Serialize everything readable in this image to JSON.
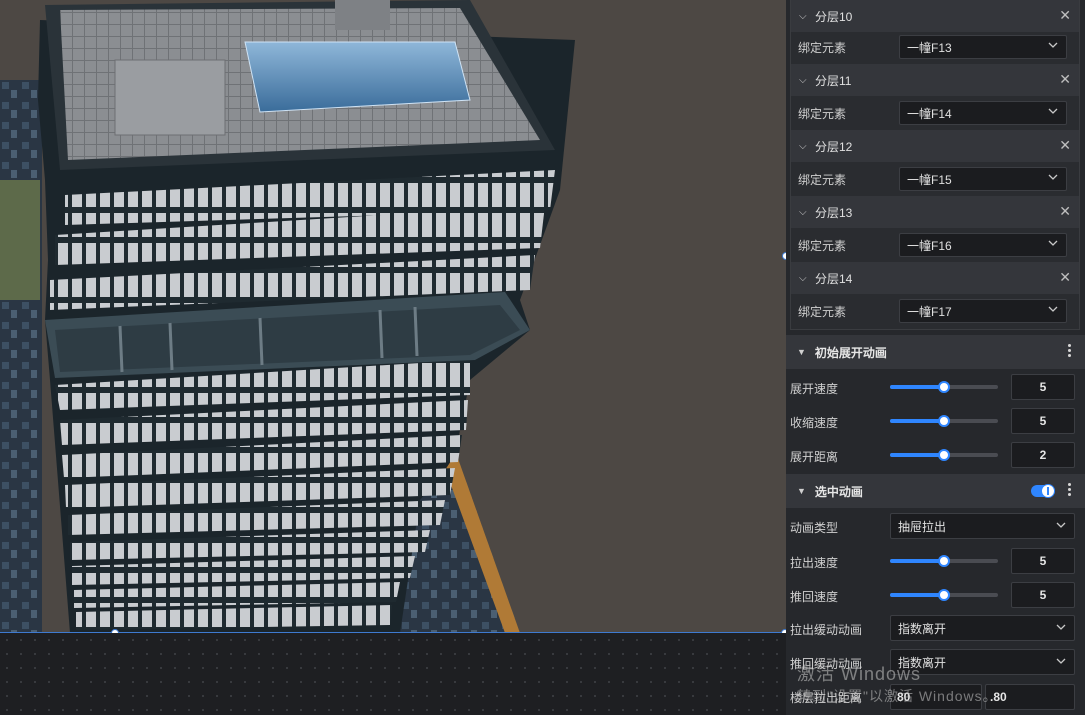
{
  "layers": [
    {
      "title": "分层10",
      "bind_label": "绑定元素",
      "bind_value": "一幢F13"
    },
    {
      "title": "分层11",
      "bind_label": "绑定元素",
      "bind_value": "一幢F14"
    },
    {
      "title": "分层12",
      "bind_label": "绑定元素",
      "bind_value": "一幢F15"
    },
    {
      "title": "分层13",
      "bind_label": "绑定元素",
      "bind_value": "一幢F16"
    },
    {
      "title": "分层14",
      "bind_label": "绑定元素",
      "bind_value": "一幢F17"
    }
  ],
  "initial_anim": {
    "title": "初始展开动画",
    "expand_speed": {
      "label": "展开速度",
      "value": "5",
      "fraction": 0.5
    },
    "shrink_speed": {
      "label": "收缩速度",
      "value": "5",
      "fraction": 0.5
    },
    "expand_distance": {
      "label": "展开距离",
      "value": "2",
      "fraction": 0.5
    }
  },
  "select_anim": {
    "title": "选中动画",
    "enabled": true,
    "anim_type": {
      "label": "动画类型",
      "value": "抽屉拉出"
    },
    "pull_speed": {
      "label": "拉出速度",
      "value": "5",
      "fraction": 0.5
    },
    "push_speed": {
      "label": "推回速度",
      "value": "5",
      "fraction": 0.5
    },
    "pull_easing": {
      "label": "拉出缓动动画",
      "value": "指数离开"
    },
    "push_easing": {
      "label": "推回缓动动画",
      "value": "指数离开"
    },
    "floor_distance": {
      "label": "楼层拉出距离",
      "value1": "80",
      "value2": ".80"
    }
  },
  "watermark": {
    "line1": "激活 Windows",
    "line2": "转到\"设置\"以激活 Windows。"
  },
  "colors": {
    "accent": "#2f86ff",
    "panel_bg": "#26282c",
    "header_bg": "#34363b",
    "viewport_bg": "#4d4844"
  }
}
